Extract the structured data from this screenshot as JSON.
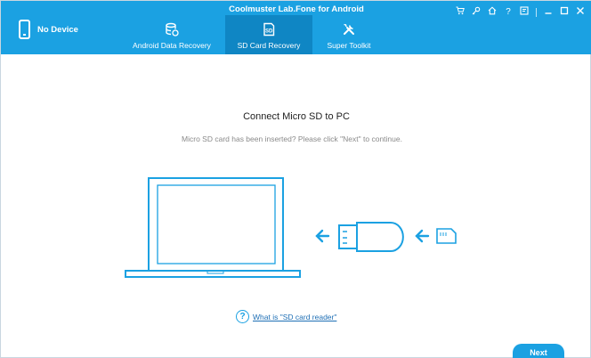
{
  "window": {
    "title": "Coolmuster Lab.Fone for Android"
  },
  "device": {
    "label": "No Device",
    "icon": "phone-icon"
  },
  "tabs": [
    {
      "label": "Android Data Recovery",
      "icon": "database-icon"
    },
    {
      "label": "SD Card Recovery",
      "icon": "sd-card-icon",
      "active": true
    },
    {
      "label": "Super Toolkit",
      "icon": "tools-icon"
    }
  ],
  "controls": [
    "cart-icon",
    "key-icon",
    "home-icon",
    "help-icon",
    "feedback-icon",
    "minimize-icon",
    "maximize-icon",
    "close-icon"
  ],
  "main": {
    "heading": "Connect Micro SD to PC",
    "subtext": "Micro SD card has been inserted? Please click \"Next\" to continue.",
    "help_link": "What is \"SD card reader\"",
    "next_label": "Next"
  },
  "colors": {
    "accent": "#1ba1e2",
    "active_tab": "#0f86c4"
  }
}
